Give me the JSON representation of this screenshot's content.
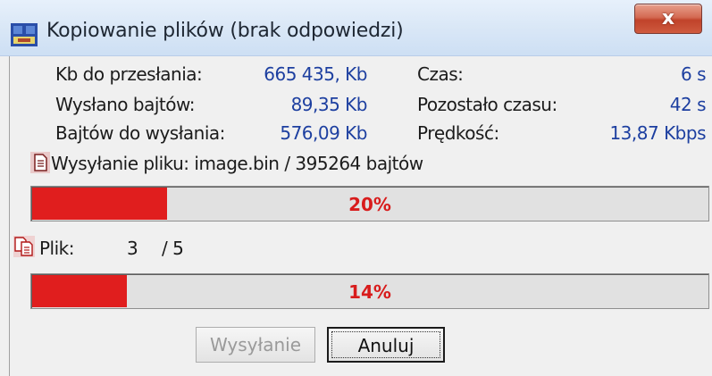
{
  "window": {
    "title": "Kopiowanie plików (brak odpowiedzi)",
    "close_label": "x"
  },
  "stats": {
    "kb_to_send_label": "Kb do przesłania:",
    "kb_to_send_value": "665 435, Kb",
    "sent_label": "Wysłano bajtów:",
    "sent_value": "89,35 Kb",
    "remaining_bytes_label": "Bajtów do wysłania:",
    "remaining_bytes_value": "576,09 Kb",
    "time_label": "Czas:",
    "time_value": "6 s",
    "time_left_label": "Pozostało czasu:",
    "time_left_value": "42 s",
    "speed_label": "Prędkość:",
    "speed_value": "13,87 Kbps"
  },
  "file_status": {
    "text": "Wysyłanie pliku: image.bin / 395264 bajtów",
    "icon": "document-icon"
  },
  "file_progress": {
    "label": "20%",
    "fraction": 0.2
  },
  "file_counter": {
    "label": "Plik:",
    "current": "3",
    "total": "/ 5",
    "icon": "copy-files-icon"
  },
  "total_progress": {
    "label": "14%",
    "fraction": 0.14
  },
  "buttons": {
    "send_label": "Wysyłanie",
    "cancel_label": "Anuluj"
  },
  "colors": {
    "progress_fill": "#e01e1e",
    "value_text": "#1d3fa0",
    "close_button": "#c9432b"
  }
}
